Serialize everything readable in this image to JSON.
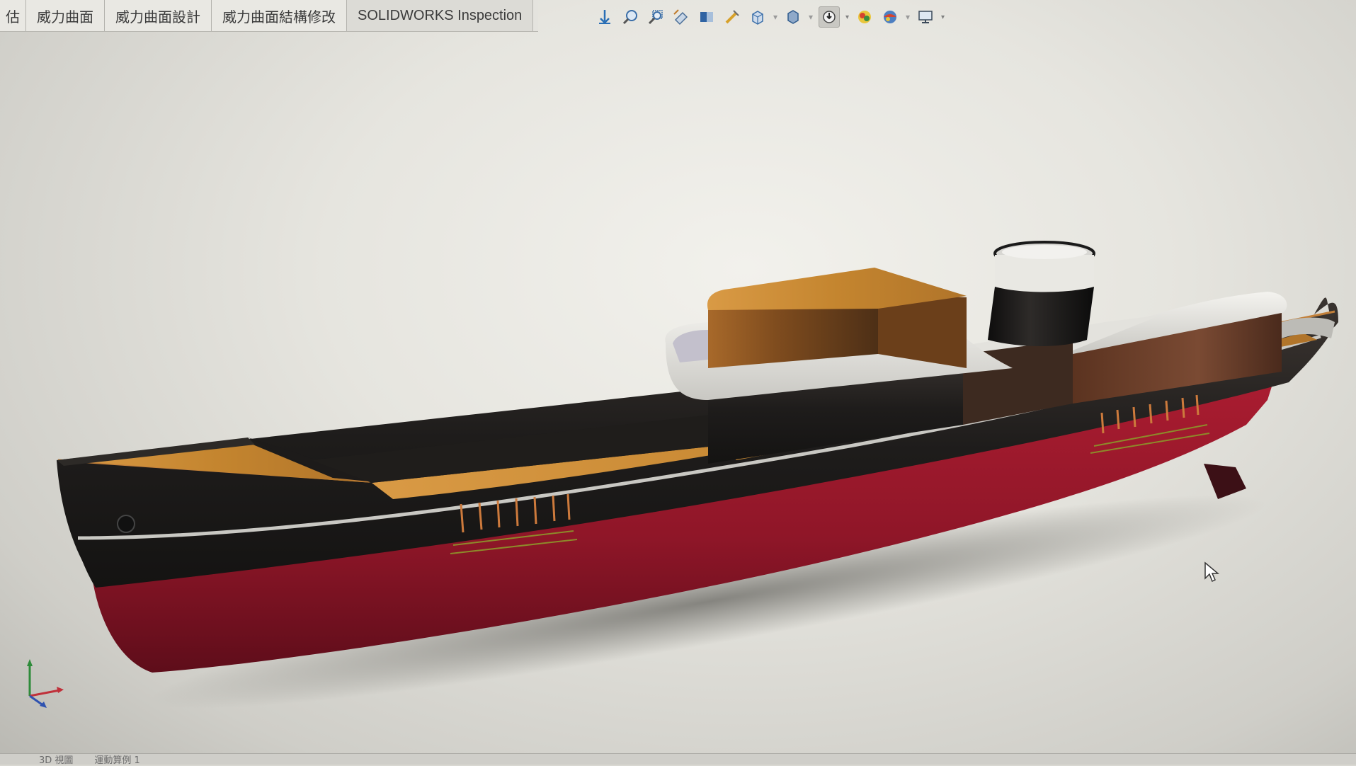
{
  "tabs": [
    {
      "label": "估"
    },
    {
      "label": "威力曲面"
    },
    {
      "label": "威力曲面設計"
    },
    {
      "label": "威力曲面結構修改"
    },
    {
      "label": "SOLIDWORKS Inspection"
    }
  ],
  "view_toolbar": [
    {
      "icon": "view-orientation-icon"
    },
    {
      "icon": "zoom-to-fit-icon"
    },
    {
      "icon": "zoom-to-area-icon"
    },
    {
      "icon": "previous-view-icon"
    },
    {
      "icon": "section-view-icon"
    },
    {
      "icon": "dynamic-annotation-icon"
    },
    {
      "icon": "view-orientation-dropdown-icon"
    },
    {
      "icon": "display-style-icon"
    },
    {
      "icon": "hide-show-items-icon"
    },
    {
      "icon": "edit-appearance-icon"
    },
    {
      "icon": "apply-scene-icon"
    },
    {
      "icon": "view-settings-icon"
    }
  ],
  "status_tabs": [
    "3D 視圖",
    "運動算例 1"
  ],
  "colors": {
    "background": "#e6e5df",
    "hull_red": "#9c1a2c",
    "hull_black": "#1f1d1c",
    "deck_wood": "#c98a36",
    "superstructure_white": "#e9e8e4"
  }
}
